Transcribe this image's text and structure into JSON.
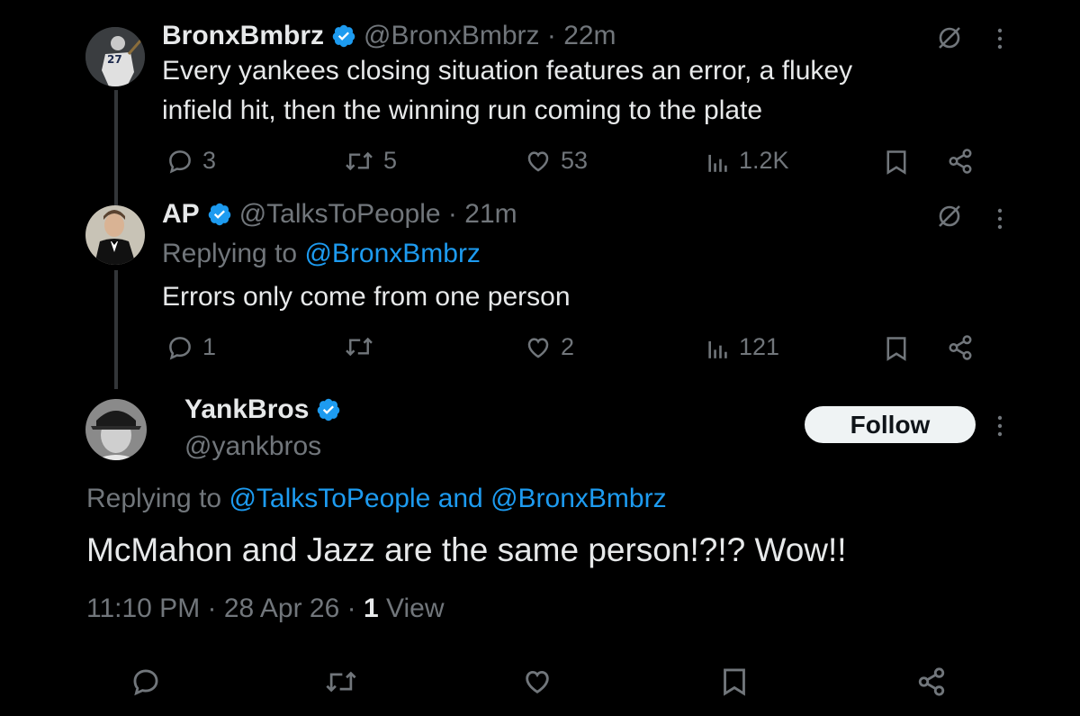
{
  "tweet1": {
    "name": "BronxBmbrz",
    "handle": "@BronxBmbrz",
    "time": "22m",
    "text_line1": "Every yankees closing situation features an error, a flukey",
    "text_line2": "infield hit, then the winning run coming to the plate",
    "replies": "3",
    "retweets": "5",
    "likes": "53",
    "views": "1.2K"
  },
  "tweet2": {
    "name": "AP",
    "handle": "@TalksToPeople",
    "time": "21m",
    "replying_prefix": "Replying to",
    "replying_to": "@BronxBmbrz",
    "text": "Errors only come from one person",
    "replies": "1",
    "retweets": "",
    "likes": "2",
    "views": "121"
  },
  "main_tweet": {
    "name": "YankBros",
    "handle": "@yankbros",
    "follow_label": "Follow",
    "replying_prefix": "Replying to",
    "replying_to_1": "@TalksToPeople",
    "replying_and": "and",
    "replying_to_2": "@BronxBmbrz",
    "text": "McMahon and Jazz are the same person!?!? Wow!!",
    "time": "11:10 PM",
    "date": "28 Apr 26",
    "views_count": "1",
    "views_label": "View"
  },
  "colors": {
    "background": "#000000",
    "text": "#e7e9ea",
    "muted": "#71767b",
    "accent": "#1d9bf0",
    "thread_line": "#333639"
  },
  "icons": [
    "verified-badge-icon",
    "grok-icon",
    "more-icon",
    "reply-icon",
    "retweet-icon",
    "like-icon",
    "views-icon",
    "bookmark-icon",
    "share-icon"
  ]
}
